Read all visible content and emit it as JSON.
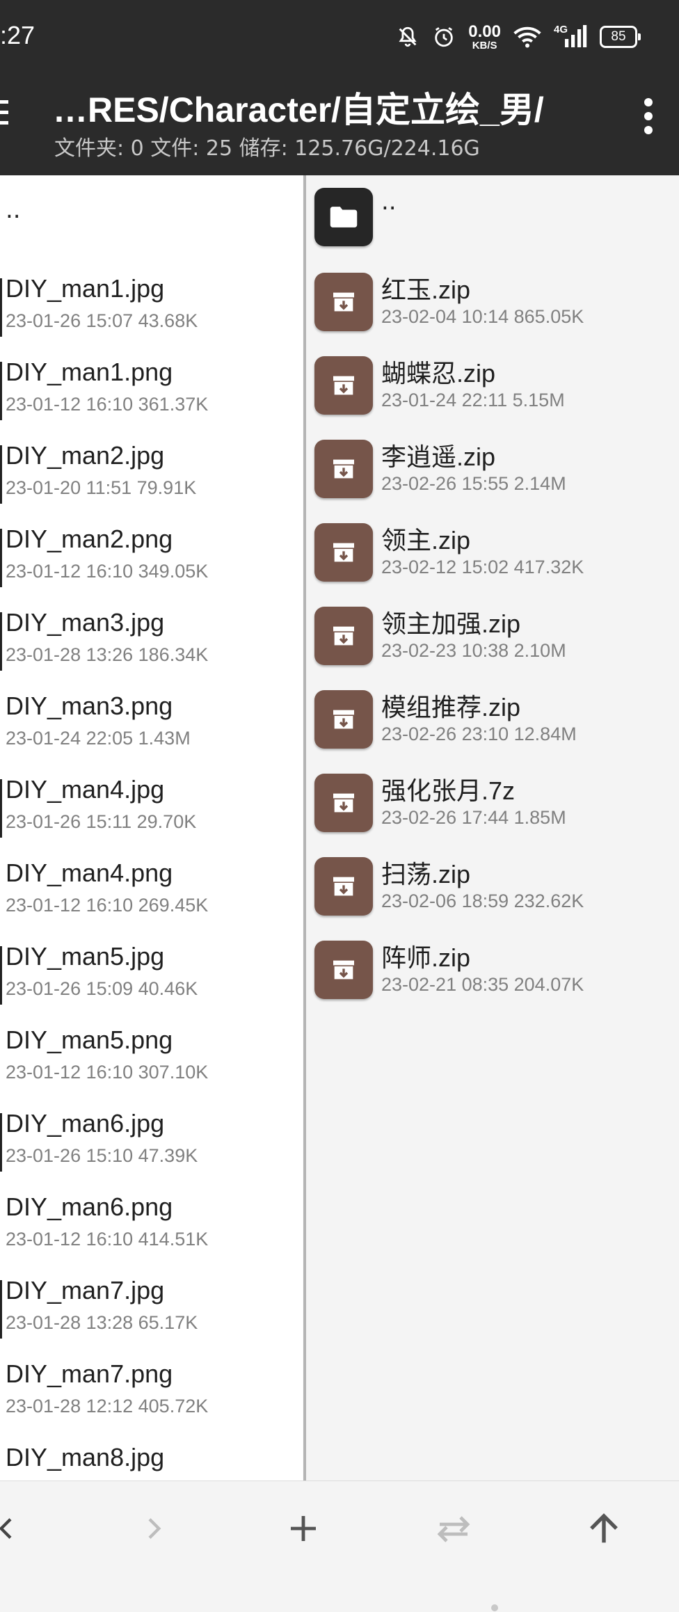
{
  "status_bar": {
    "time": ":27",
    "net_speed_value": "0.00",
    "net_speed_unit": "KB/S",
    "network_type": "4G",
    "battery": "85",
    "icons": [
      "bell-off-icon",
      "alarm-icon",
      "wifi-icon",
      "signal-icon",
      "battery-icon"
    ]
  },
  "toolbar": {
    "path": "…RES/Character/自定立绘_男/",
    "stats": "文件夹: 0  文件: 25  储存: 125.76G/224.16G",
    "menu_icon": "hamburger-icon",
    "more_icon": "more-vert-icon"
  },
  "left_panel": {
    "parent_label": "..",
    "items": [
      {
        "name": "DIY_man1.jpg",
        "meta": "23-01-26 15:07  43.68K"
      },
      {
        "name": "DIY_man1.png",
        "meta": "23-01-12 16:10  361.37K"
      },
      {
        "name": "DIY_man2.jpg",
        "meta": "23-01-20 11:51  79.91K"
      },
      {
        "name": "DIY_man2.png",
        "meta": "23-01-12 16:10  349.05K"
      },
      {
        "name": "DIY_man3.jpg",
        "meta": "23-01-28 13:26  186.34K"
      },
      {
        "name": "DIY_man3.png",
        "meta": "23-01-24 22:05  1.43M"
      },
      {
        "name": "DIY_man4.jpg",
        "meta": "23-01-26 15:11  29.70K"
      },
      {
        "name": "DIY_man4.png",
        "meta": "23-01-12 16:10  269.45K"
      },
      {
        "name": "DIY_man5.jpg",
        "meta": "23-01-26 15:09  40.46K"
      },
      {
        "name": "DIY_man5.png",
        "meta": "23-01-12 16:10  307.10K"
      },
      {
        "name": "DIY_man6.jpg",
        "meta": "23-01-26 15:10  47.39K"
      },
      {
        "name": "DIY_man6.png",
        "meta": "23-01-12 16:10  414.51K"
      },
      {
        "name": "DIY_man7.jpg",
        "meta": "23-01-28 13:28  65.17K"
      },
      {
        "name": "DIY_man7.png",
        "meta": "23-01-28 12:12  405.72K"
      },
      {
        "name": "DIY_man8.jpg",
        "meta": ""
      }
    ]
  },
  "right_panel": {
    "parent_label": "..",
    "items": [
      {
        "name": "红玉.zip",
        "meta": "23-02-04 10:14  865.05K"
      },
      {
        "name": "蝴蝶忍.zip",
        "meta": "23-01-24 22:11  5.15M"
      },
      {
        "name": "李逍遥.zip",
        "meta": "23-02-26 15:55  2.14M"
      },
      {
        "name": "领主.zip",
        "meta": "23-02-12 15:02  417.32K"
      },
      {
        "name": "领主加强.zip",
        "meta": "23-02-23 10:38  2.10M"
      },
      {
        "name": "模组推荐.zip",
        "meta": "23-02-26 23:10  12.84M"
      },
      {
        "name": "强化张月.7z",
        "meta": "23-02-26 17:44  1.85M"
      },
      {
        "name": "扫荡.zip",
        "meta": "23-02-06 18:59  232.62K"
      },
      {
        "name": "阵师.zip",
        "meta": "23-02-21 08:35  204.07K"
      }
    ]
  },
  "bottom_bar": {
    "buttons": [
      "back-icon",
      "forward-icon",
      "add-icon",
      "swap-icon",
      "up-icon"
    ],
    "forward_disabled": true,
    "swap_disabled": true
  },
  "colors": {
    "toolbar_bg": "#2b2b2b",
    "archive_icon_bg": "#76554a",
    "folder_icon_bg": "#262626"
  }
}
